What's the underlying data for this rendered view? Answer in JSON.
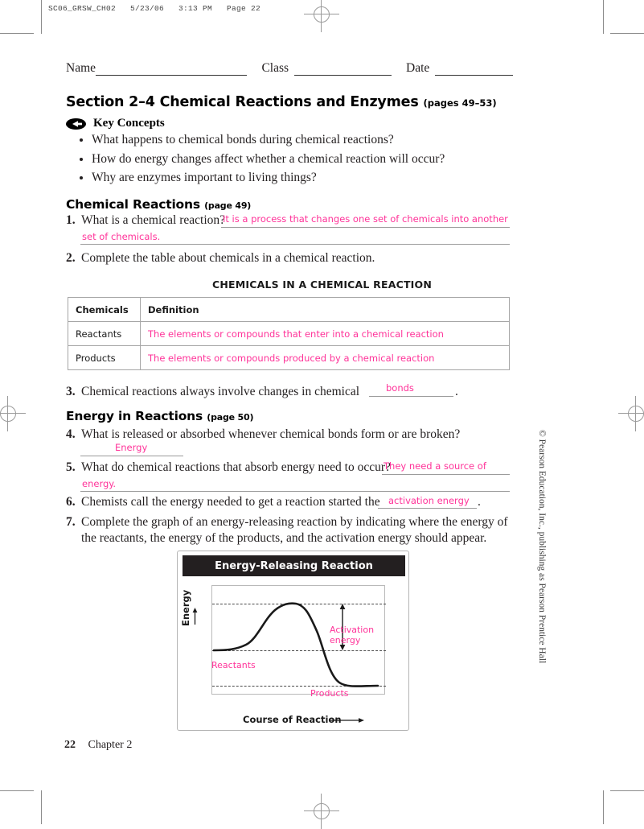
{
  "print_slug": "SC06_GRSW_CH02   5/23/06   3:13 PM   Page 22",
  "accent_color": "#ff3399",
  "form_fields": {
    "name_label": "Name",
    "class_label": "Class",
    "date_label": "Date"
  },
  "section": {
    "title": "Section 2–4  Chemical Reactions and Enzymes",
    "pages": "(pages 49–53)",
    "key_concepts_heading": "Key Concepts",
    "key_concepts": [
      "What happens to chemical bonds during chemical reactions?",
      "How do energy changes affect whether a chemical reaction will occur?",
      "Why are enzymes important to living things?"
    ]
  },
  "chemical_reactions": {
    "heading": "Chemical Reactions",
    "page_ref": "(page 49)",
    "q1": {
      "num": "1.",
      "text": "What is a chemical reaction?",
      "answer_line1": "It is a process that changes one set of chemicals into another",
      "answer_line2": "set of chemicals."
    },
    "q2": {
      "num": "2.",
      "text": "Complete the table about chemicals in a chemical reaction."
    },
    "table": {
      "title": "CHEMICALS IN A CHEMICAL REACTION",
      "headers": [
        "Chemicals",
        "Definition"
      ],
      "rows": [
        [
          "Reactants",
          "The elements or compounds that enter into a chemical reaction"
        ],
        [
          "Products",
          "The elements or compounds produced by a chemical reaction"
        ]
      ]
    },
    "q3": {
      "num": "3.",
      "text_before": "Chemical reactions always involve changes in chemical",
      "answer": "bonds",
      "text_after": "."
    }
  },
  "energy_in_reactions": {
    "heading": "Energy in Reactions",
    "page_ref": "(page 50)",
    "q4": {
      "num": "4.",
      "text": "What is released or absorbed whenever chemical bonds form or are broken?",
      "answer": "Energy"
    },
    "q5": {
      "num": "5.",
      "text": "What do chemical reactions that absorb energy need to occur?",
      "answer_line1": "They need a source of",
      "answer_line2": "energy."
    },
    "q6": {
      "num": "6.",
      "text_before": "Chemists call the energy needed to get a reaction started the",
      "answer": "activation energy",
      "text_after": "."
    },
    "q7": {
      "num": "7.",
      "text_line1": "Complete the graph of an energy-releasing reaction by indicating where the energy of",
      "text_line2": "the reactants, the energy of the products, and the activation energy should appear."
    }
  },
  "chart_data": {
    "type": "line",
    "title": "Energy-Releasing Reaction",
    "xlabel": "Course of Reaction",
    "ylabel": "Energy",
    "grid": false,
    "annotations": [
      {
        "label": "Activation energy",
        "color": "#ff3399"
      },
      {
        "label": "Reactants",
        "color": "#ff3399"
      },
      {
        "label": "Products",
        "color": "#ff3399"
      }
    ],
    "levels": {
      "reactants_energy": 0.42,
      "peak_energy": 0.85,
      "products_energy": 0.1
    },
    "x": [
      0.0,
      0.08,
      0.16,
      0.24,
      0.32,
      0.4,
      0.48,
      0.56,
      0.64,
      0.72,
      0.8,
      0.88,
      0.96,
      1.0
    ],
    "y": [
      0.42,
      0.42,
      0.43,
      0.46,
      0.55,
      0.68,
      0.8,
      0.85,
      0.82,
      0.68,
      0.42,
      0.2,
      0.11,
      0.1
    ],
    "xlim": [
      0,
      1
    ],
    "ylim": [
      0,
      1
    ]
  },
  "copyright": "© Pearson Education, Inc., publishing as Pearson Prentice Hall",
  "footer": {
    "page_number": "22",
    "chapter": "Chapter 2"
  }
}
